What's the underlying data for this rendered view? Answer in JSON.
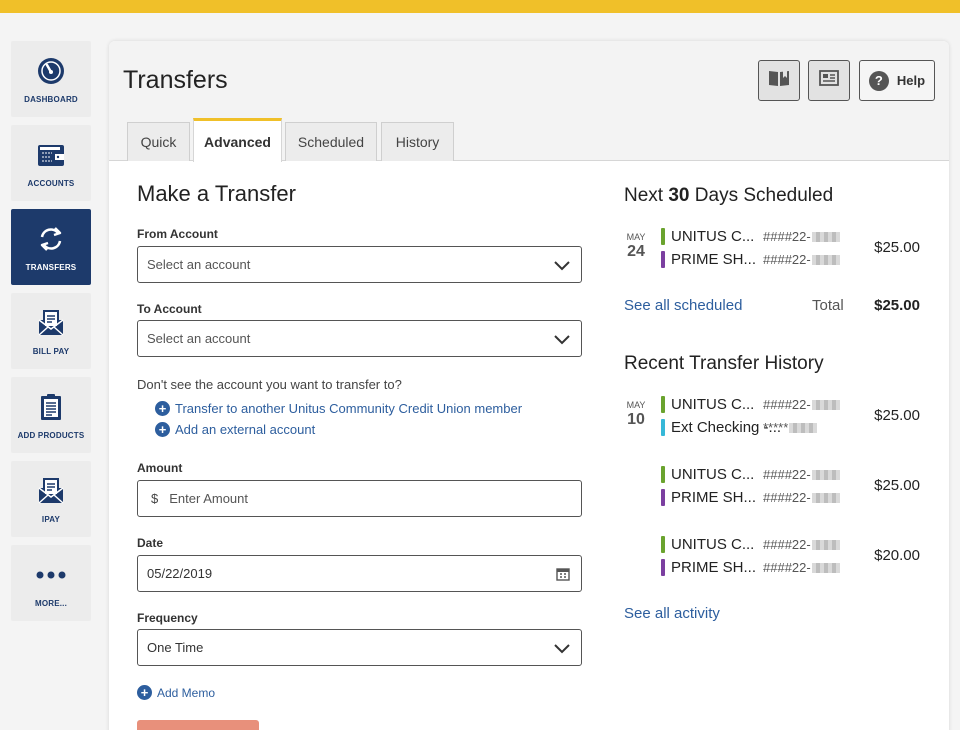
{
  "colors": {
    "accent": "#f0c029",
    "navy": "#1d3a6b",
    "link": "#2d5e9e",
    "green": "#6aa32e",
    "purple": "#7b3fa0",
    "cyan": "#36b8d8"
  },
  "sidebar": {
    "items": [
      {
        "label": "DASHBOARD",
        "icon": "gauge-icon"
      },
      {
        "label": "ACCOUNTS",
        "icon": "wallet-icon"
      },
      {
        "label": "TRANSFERS",
        "icon": "transfer-arrows-icon",
        "active": true
      },
      {
        "label": "BILL PAY",
        "icon": "envelope-icon"
      },
      {
        "label": "ADD PRODUCTS",
        "icon": "clipboard-icon"
      },
      {
        "label": "IPAY",
        "icon": "envelope-icon"
      },
      {
        "label": "MORE...",
        "icon": "more-dots-icon"
      }
    ]
  },
  "header": {
    "title": "Transfers",
    "buttons": {
      "help_label": "Help",
      "help_glyph": "?"
    },
    "tabs": [
      {
        "label": "Quick"
      },
      {
        "label": "Advanced",
        "active": true
      },
      {
        "label": "Scheduled"
      },
      {
        "label": "History"
      }
    ]
  },
  "form": {
    "title": "Make a Transfer",
    "from": {
      "label": "From Account",
      "placeholder": "Select an account"
    },
    "to": {
      "label": "To Account",
      "placeholder": "Select an account"
    },
    "missing_question": "Don't see the account you want to transfer to?",
    "link_member": "Transfer to another Unitus Community Credit Union member",
    "link_external": "Add an external account",
    "amount": {
      "label": "Amount",
      "currency": "$",
      "placeholder": "Enter Amount"
    },
    "date": {
      "label": "Date",
      "value": "05/22/2019"
    },
    "frequency": {
      "label": "Frequency",
      "value": "One Time"
    },
    "memo_link": "Add Memo",
    "plus_glyph": "+"
  },
  "scheduled": {
    "title_pre": "Next ",
    "title_bold": "30",
    "title_post": " Days Scheduled",
    "entry": {
      "month": "MAY",
      "day": "24",
      "from": {
        "name": "UNITUS C...",
        "number": "####22-"
      },
      "to": {
        "name": "PRIME SH...",
        "number": "####22-"
      },
      "amount": "$25.00"
    },
    "see_all": "See all scheduled",
    "total_label": "Total",
    "total_value": "$25.00"
  },
  "history": {
    "title": "Recent Transfer History",
    "month": "MAY",
    "day": "10",
    "entries": [
      {
        "from": {
          "name": "UNITUS C...",
          "number": "####22-"
        },
        "to": {
          "name": "Ext Checking -...",
          "number": "*****"
        },
        "amount": "$25.00"
      },
      {
        "from": {
          "name": "UNITUS C...",
          "number": "####22-"
        },
        "to": {
          "name": "PRIME SH...",
          "number": "####22-"
        },
        "amount": "$25.00"
      },
      {
        "from": {
          "name": "UNITUS C...",
          "number": "####22-"
        },
        "to": {
          "name": "PRIME SH...",
          "number": "####22-"
        },
        "amount": "$20.00"
      }
    ],
    "see_all": "See all activity"
  }
}
